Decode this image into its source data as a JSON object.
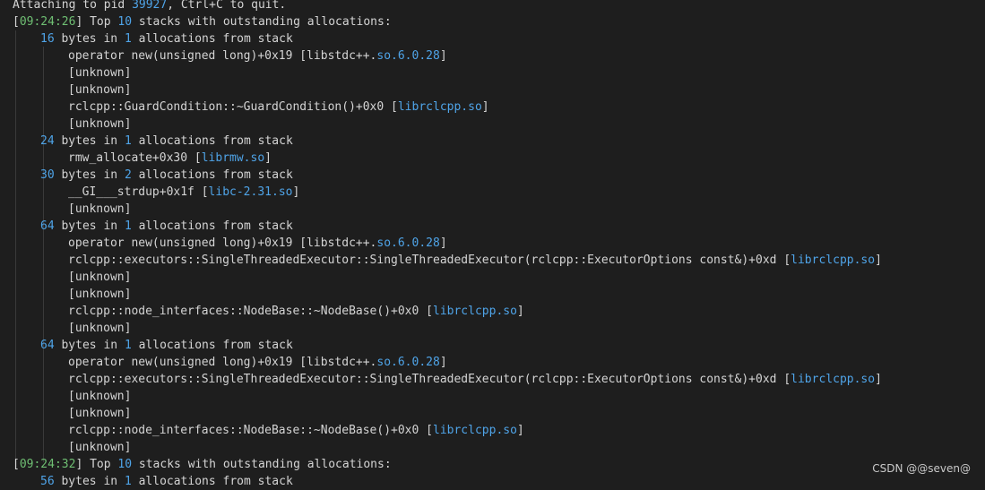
{
  "header": "Attaching to pid 39927, Ctrl+C to quit.",
  "lines": [
    {
      "type": "attach",
      "prefix": "Attaching to pid ",
      "pid": "39927",
      "suffix": ", Ctrl+C to quit."
    },
    {
      "type": "top",
      "timestamp": "09:24:26",
      "count": "10",
      "text": " stacks with outstanding allocations:"
    },
    {
      "type": "alloc",
      "bytes": "16",
      "allocs": "1"
    },
    {
      "type": "frame",
      "text": "operator new(unsigned long)+0x19 [libstdc++.",
      "lib": "so.6.0.28",
      "close": "]"
    },
    {
      "type": "plain",
      "text": "[unknown]"
    },
    {
      "type": "plain",
      "text": "[unknown]"
    },
    {
      "type": "frame",
      "text": "rclcpp::GuardCondition::~GuardCondition()+0x0 [",
      "lib": "librclcpp.so",
      "close": "]"
    },
    {
      "type": "plain",
      "text": "[unknown]"
    },
    {
      "type": "alloc",
      "bytes": "24",
      "allocs": "1"
    },
    {
      "type": "frame",
      "text": "rmw_allocate+0x30 [",
      "lib": "librmw.so",
      "close": "]"
    },
    {
      "type": "alloc",
      "bytes": "30",
      "allocs": "2"
    },
    {
      "type": "frame",
      "text": "__GI___strdup+0x1f [",
      "lib": "libc-2.31.so",
      "close": "]"
    },
    {
      "type": "plain",
      "text": "[unknown]"
    },
    {
      "type": "alloc",
      "bytes": "64",
      "allocs": "1"
    },
    {
      "type": "frame",
      "text": "operator new(unsigned long)+0x19 [libstdc++.",
      "lib": "so.6.0.28",
      "close": "]"
    },
    {
      "type": "frame",
      "text": "rclcpp::executors::SingleThreadedExecutor::SingleThreadedExecutor(rclcpp::ExecutorOptions const&)+0xd [",
      "lib": "librclcpp.so",
      "close": "]"
    },
    {
      "type": "plain",
      "text": "[unknown]"
    },
    {
      "type": "plain",
      "text": "[unknown]"
    },
    {
      "type": "frame",
      "text": "rclcpp::node_interfaces::NodeBase::~NodeBase()+0x0 [",
      "lib": "librclcpp.so",
      "close": "]"
    },
    {
      "type": "plain",
      "text": "[unknown]"
    },
    {
      "type": "alloc",
      "bytes": "64",
      "allocs": "1"
    },
    {
      "type": "frame",
      "text": "operator new(unsigned long)+0x19 [libstdc++.",
      "lib": "so.6.0.28",
      "close": "]"
    },
    {
      "type": "frame",
      "text": "rclcpp::executors::SingleThreadedExecutor::SingleThreadedExecutor(rclcpp::ExecutorOptions const&)+0xd [",
      "lib": "librclcpp.so",
      "close": "]"
    },
    {
      "type": "plain",
      "text": "[unknown]"
    },
    {
      "type": "plain",
      "text": "[unknown]"
    },
    {
      "type": "frame",
      "text": "rclcpp::node_interfaces::NodeBase::~NodeBase()+0x0 [",
      "lib": "librclcpp.so",
      "close": "]"
    },
    {
      "type": "plain",
      "text": "[unknown]"
    },
    {
      "type": "top",
      "timestamp": "09:24:32",
      "count": "10",
      "text": " stacks with outstanding allocations:"
    },
    {
      "type": "alloc",
      "bytes": "56",
      "allocs": "1"
    }
  ],
  "strings": {
    "bytes_in": " bytes in ",
    "allocs_from": " allocations from stack",
    "top": "] Top ",
    "open_bracket": "["
  },
  "watermark": "CSDN @@seven@",
  "colors": {
    "background": "#1e1e1e",
    "text": "#d4d4d4",
    "number": "#4fa4e8",
    "timestamp": "#6fbf73"
  }
}
